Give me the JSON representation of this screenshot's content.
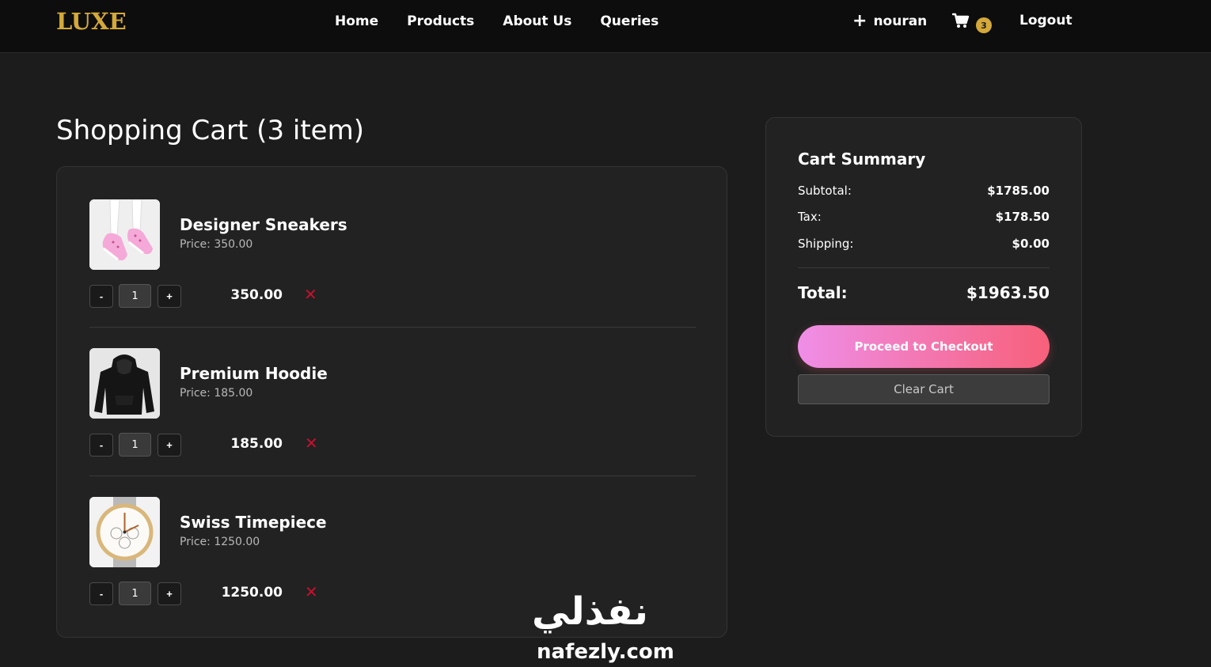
{
  "brand": {
    "logo": "LUXE",
    "accent_color": "#d4a93a"
  },
  "nav": {
    "links": [
      "Home",
      "Products",
      "About Us",
      "Queries"
    ],
    "user_label": "nouran",
    "user_icon": "plus-icon",
    "cart_icon": "cart-icon",
    "cart_count": "3",
    "logout_label": "Logout"
  },
  "cart": {
    "heading": "Shopping Cart (3 item)",
    "items": [
      {
        "name": "Designer Sneakers",
        "price": "Price: 350.00",
        "quantity": "1",
        "total": "350.00",
        "image": "pink-sneakers-image",
        "dec": "-",
        "inc": "+",
        "remove": "✕"
      },
      {
        "name": "Premium Hoodie",
        "price": "Price: 185.00",
        "quantity": "1",
        "total": "185.00",
        "image": "black-hoodie-image",
        "dec": "-",
        "inc": "+",
        "remove": "✕"
      },
      {
        "name": "Swiss Timepiece",
        "price": "Price: 1250.00",
        "quantity": "1",
        "total": "1250.00",
        "image": "wristwatch-image",
        "dec": "-",
        "inc": "+",
        "remove": "✕"
      }
    ]
  },
  "summary": {
    "title": "Cart Summary",
    "subtotal_label": "Subtotal:",
    "subtotal_value": "$1785.00",
    "tax_label": "Tax:",
    "tax_value": "$178.50",
    "shipping_label": "Shipping:",
    "shipping_value": "$0.00",
    "total_label": "Total:",
    "total_value": "$1963.50",
    "checkout_label": "Proceed to Checkout",
    "clear_label": "Clear Cart"
  },
  "watermark": {
    "arabic": "نفذلي",
    "latin": "nafezly.com"
  }
}
